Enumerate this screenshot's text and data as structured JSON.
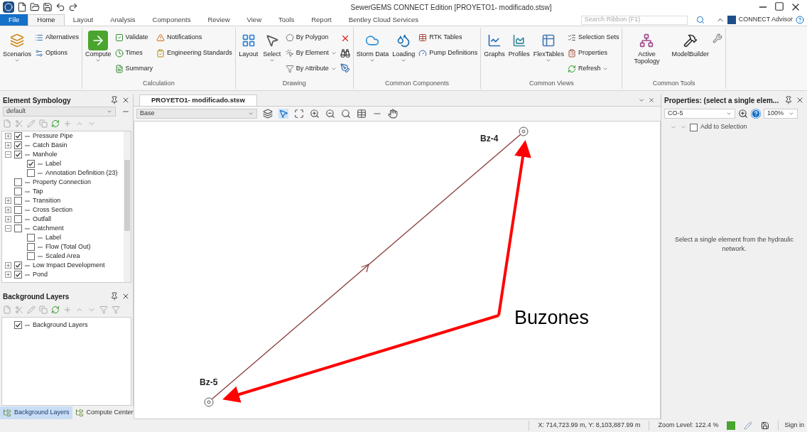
{
  "window": {
    "title": "SewerGEMS CONNECT Edition [PROYETO1- modificado.stsw]"
  },
  "ribbon_tabs": [
    {
      "label": "File",
      "kind": "file",
      "selected": false
    },
    {
      "label": "Home",
      "kind": "tab",
      "selected": true
    },
    {
      "label": "Layout",
      "kind": "tab",
      "selected": false
    },
    {
      "label": "Analysis",
      "kind": "tab",
      "selected": false
    },
    {
      "label": "Components",
      "kind": "tab",
      "selected": false
    },
    {
      "label": "Review",
      "kind": "tab",
      "selected": false
    },
    {
      "label": "View",
      "kind": "tab",
      "selected": false
    },
    {
      "label": "Tools",
      "kind": "tab",
      "selected": false
    },
    {
      "label": "Report",
      "kind": "tab",
      "selected": false
    },
    {
      "label": "Bentley Cloud Services",
      "kind": "tab",
      "selected": false
    }
  ],
  "search": {
    "placeholder": "Search Ribbon (F1)"
  },
  "connect_advisor": "CONNECT Advisor",
  "ribbon_groups": [
    {
      "items": [
        {
          "label": "Scenarios",
          "kind": "large",
          "dropdown": true
        },
        {
          "label": "Alternatives",
          "kind": "small"
        },
        {
          "label": "Options",
          "kind": "small"
        }
      ]
    },
    {
      "title": "Calculation",
      "items": [
        {
          "label": "Compute",
          "kind": "large",
          "dropdown": true
        },
        {
          "label": "Validate",
          "kind": "small"
        },
        {
          "label": "Times",
          "kind": "small"
        },
        {
          "label": "Summary",
          "kind": "small"
        },
        {
          "label": "Notifications",
          "kind": "small"
        },
        {
          "label": "Engineering Standards",
          "kind": "small"
        }
      ]
    },
    {
      "title": "Drawing",
      "items": [
        {
          "label": "Layout",
          "kind": "large"
        },
        {
          "label": "Select",
          "kind": "large",
          "dropdown": true
        },
        {
          "label": "By Polygon",
          "kind": "small"
        },
        {
          "label": "By Element",
          "kind": "small",
          "dropdown": true
        },
        {
          "label": "By Attribute",
          "kind": "small",
          "dropdown": true
        }
      ]
    },
    {
      "title": "Common Components",
      "items": [
        {
          "label": "Storm Data",
          "kind": "large",
          "dropdown": true
        },
        {
          "label": "Loading",
          "kind": "large",
          "dropdown": true
        },
        {
          "label": "RTK Tables",
          "kind": "small"
        },
        {
          "label": "Pump Definitions",
          "kind": "small"
        }
      ]
    },
    {
      "title": "Common Views",
      "items": [
        {
          "label": "Graphs",
          "kind": "large"
        },
        {
          "label": "Profiles",
          "kind": "large"
        },
        {
          "label": "FlexTables",
          "kind": "large",
          "dropdown": true
        },
        {
          "label": "Selection Sets",
          "kind": "small"
        },
        {
          "label": "Properties",
          "kind": "small"
        },
        {
          "label": "Refresh",
          "kind": "small",
          "dropdown": true
        }
      ]
    },
    {
      "title": "Common Tools",
      "items": [
        {
          "label": "Active Topology",
          "kind": "large"
        },
        {
          "label": "ModelBuilder",
          "kind": "large"
        }
      ]
    }
  ],
  "symbology": {
    "title": "Element Symbology",
    "dropdown": "default",
    "tree": [
      {
        "label": "Pressure Pipe",
        "checked": true,
        "expanded": false
      },
      {
        "label": "Catch Basin",
        "checked": true,
        "expanded": false
      },
      {
        "label": "Manhole",
        "checked": true,
        "expanded": true,
        "children": [
          {
            "label": "Label",
            "checked": true
          },
          {
            "label": "Annotation Definition (23)",
            "checked": false
          }
        ]
      },
      {
        "label": "Property Connection",
        "checked": false
      },
      {
        "label": "Tap",
        "checked": false
      },
      {
        "label": "Transition",
        "checked": false,
        "expanded": false
      },
      {
        "label": "Cross Section",
        "checked": false,
        "expanded": false
      },
      {
        "label": "Outfall",
        "checked": false,
        "expanded": false
      },
      {
        "label": "Catchment",
        "checked": false,
        "expanded": true,
        "children": [
          {
            "label": "Label",
            "checked": false
          },
          {
            "label": "Flow (Total Out)",
            "checked": false
          },
          {
            "label": "Scaled Area",
            "checked": false
          }
        ]
      },
      {
        "label": "Low Impact Development",
        "checked": true,
        "expanded": false
      },
      {
        "label": "Pond",
        "checked": true,
        "expanded": false
      }
    ]
  },
  "background_layers": {
    "title": "Background Layers",
    "tree": [
      {
        "label": "Background Layers",
        "checked": true
      }
    ]
  },
  "bottom_tabs": [
    {
      "label": "Background Layers",
      "selected": true
    },
    {
      "label": "Compute Center",
      "selected": false
    }
  ],
  "document": {
    "tab": "PROYETO1- modificado.stsw",
    "layer_dropdown": "Base",
    "nodes": [
      {
        "label": "Bz-4"
      },
      {
        "label": "Bz-5"
      }
    ],
    "annotation": "Buzones"
  },
  "properties": {
    "title": "Properties: (select a single elem...",
    "element_dropdown": "CO-5",
    "zoom_dropdown": "100%",
    "add_to_selection": {
      "label": "Add to Selection",
      "checked": false
    },
    "message": "Select a single element from the hydraulic network."
  },
  "status_bar": {
    "coordinates": "X: 714,723.99 m, Y: 8,103,887.99 m",
    "zoom": "Zoom Level: 122.4 %",
    "sign_in": "Sign in"
  }
}
